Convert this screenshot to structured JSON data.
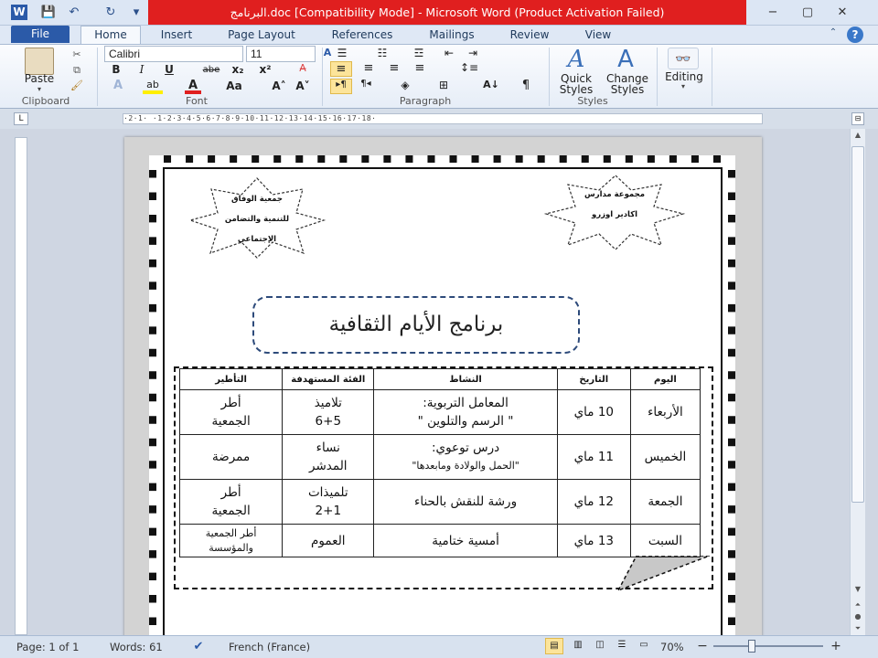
{
  "window": {
    "title": "البرنامج.doc [Compatibility Mode] - Microsoft Word (Product Activation Failed)",
    "app_icon": "W",
    "qat": {
      "save": "💾",
      "undo": "↶",
      "redo": "↻",
      "customize": "▾"
    },
    "controls": {
      "minimize": "−",
      "restore": "▢",
      "close": "✕"
    }
  },
  "tabs": {
    "file": "File",
    "home": "Home",
    "insert": "Insert",
    "page_layout": "Page Layout",
    "references": "References",
    "mailings": "Mailings",
    "review": "Review",
    "view": "View"
  },
  "ribbon": {
    "clipboard": {
      "label": "Clipboard",
      "paste": "Paste"
    },
    "font": {
      "label": "Font",
      "family": "Calibri",
      "size": "11",
      "bold": "B",
      "italic": "I",
      "underline": "U",
      "strike": "abe",
      "sub": "x₂",
      "sup": "x²",
      "grow": "A˄",
      "shrink": "A˅",
      "case": "Aa"
    },
    "paragraph": {
      "label": "Paragraph"
    },
    "styles": {
      "label": "Styles",
      "quick": "Quick",
      "quick2": "Styles",
      "change": "Change",
      "change2": "Styles"
    },
    "editing": {
      "label": "Editing"
    }
  },
  "ruler": {
    "marks": "·2·1·  ·1·2·3·4·5·6·7·8·9·10·11·12·13·14·15·16·17·18·"
  },
  "document": {
    "star_left": {
      "l1": "جمعية الوفاق",
      "l2": "للتنمية والتضامن",
      "l3": "الإجتماعي"
    },
    "star_right": {
      "l1": "مجموعة مدارس",
      "l2": "اكادير اوزرو"
    },
    "banner": "برنامج الأيام الثقافية",
    "table": {
      "headers": [
        "اليوم",
        "التاريخ",
        "النشاط",
        "الفئة المستهدفة",
        "التأطير"
      ],
      "rows": [
        {
          "day": "الأربعاء",
          "date": "10 ماي",
          "activity_1": "المعامل التربوية:",
          "activity_2": "\" الرسم والتلوين \"",
          "target_1": "تلاميذ",
          "target_2": "6+5",
          "staff_1": "أطر",
          "staff_2": "الجمعية"
        },
        {
          "day": "الخميس",
          "date": "11 ماي",
          "activity_1": "درس توعوي:",
          "activity_2": "\"الحمل والولادة ومابعدها\"",
          "target_1": "نساء",
          "target_2": "المدشر",
          "staff_1": "ممرضة",
          "staff_2": ""
        },
        {
          "day": "الجمعة",
          "date": "12 ماي",
          "activity_1": "ورشة للنقش بالحناء",
          "activity_2": "",
          "target_1": "تلميذات",
          "target_2": "2+1",
          "staff_1": "أطر",
          "staff_2": "الجمعية"
        },
        {
          "day": "السبت",
          "date": "13 ماي",
          "activity_1": "أمسية ختامية",
          "activity_2": "",
          "target_1": "العموم",
          "target_2": "",
          "staff_1": "أطر الجمعية",
          "staff_2": "والمؤسسة"
        }
      ]
    }
  },
  "status": {
    "page": "Page: 1 of 1",
    "words": "Words: 61",
    "language": "French (France)",
    "zoom": "70%",
    "minus": "−",
    "plus": "+"
  }
}
